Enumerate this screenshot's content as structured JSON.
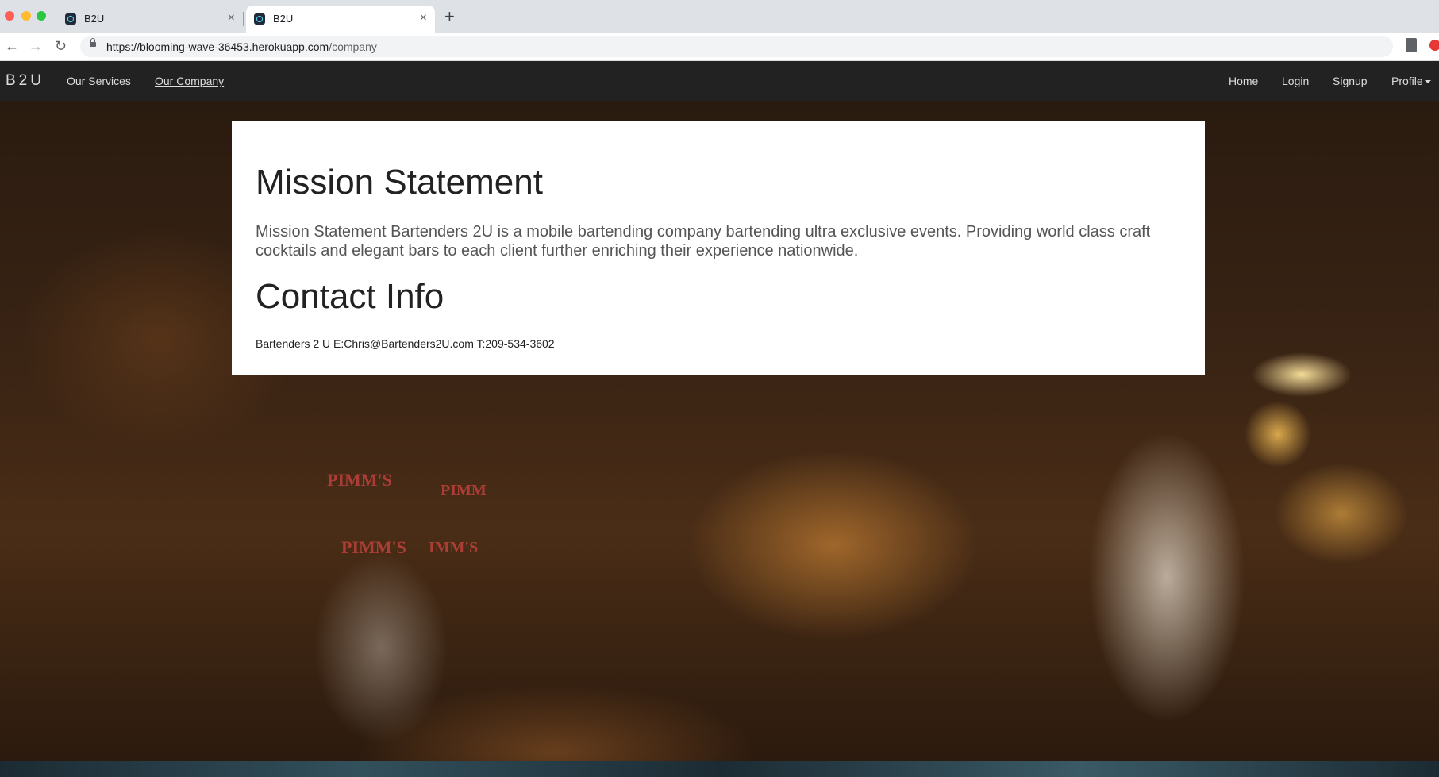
{
  "browser": {
    "tabs": [
      {
        "title": "B2U",
        "close": "×"
      },
      {
        "title": "B2U",
        "close": "×"
      }
    ],
    "new_tab": "+",
    "url_prefix": "https://",
    "url_host": "blooming-wave-36453.herokuapp.com",
    "url_path": "/company"
  },
  "navbar": {
    "brand": "B2U",
    "left_links": [
      {
        "label": "Our Services"
      },
      {
        "label": "Our Company"
      }
    ],
    "right_links": [
      {
        "label": "Home"
      },
      {
        "label": "Login"
      },
      {
        "label": "Signup"
      },
      {
        "label": "Profile"
      }
    ]
  },
  "hero_sign_text": [
    "PIMM'S",
    "PIMM'S",
    "PIMM",
    "IMM'S"
  ],
  "content": {
    "mission_heading": "Mission Statement",
    "mission_text": "Mission Statement Bartenders 2U is a mobile bartending company bartending ultra exclusive events. Providing world class craft cocktails and elegant bars to each client further enriching their experience nationwide.",
    "contact_heading": "Contact Info",
    "contact_text": "Bartenders 2 U E:Chris@Bartenders2U.com T:209-534-3602"
  },
  "colors": {
    "navbar_bg": "#222222",
    "nav_text": "#dddddd",
    "card_bg": "#ffffff"
  },
  "icons": [
    "back-arrow-icon",
    "forward-arrow-icon",
    "reload-icon",
    "lock-icon",
    "extension-icon",
    "react-favicon-icon",
    "close-icon",
    "plus-icon",
    "caret-down-icon"
  ]
}
